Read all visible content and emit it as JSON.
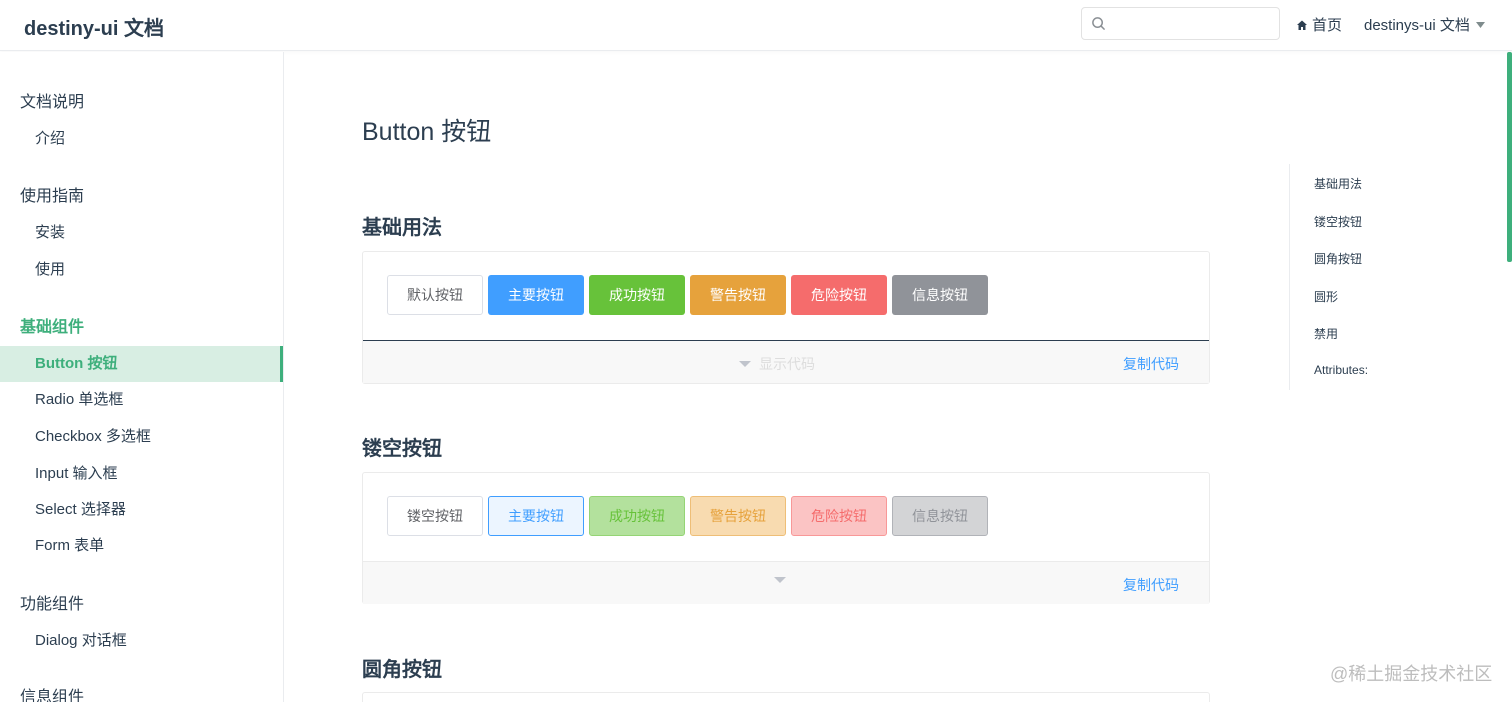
{
  "header": {
    "brand": "destiny-ui 文档",
    "search": {
      "value": "",
      "placeholder": ""
    },
    "home_label": "首页",
    "dropdown_label": "destinys-ui 文档"
  },
  "sidebar": {
    "groups": [
      {
        "title": "文档说明",
        "items": [
          "介绍"
        ]
      },
      {
        "title": "使用指南",
        "items": [
          "安装",
          "使用"
        ]
      },
      {
        "title": "基础组件",
        "items": [
          "Button 按钮",
          "Radio 单选框",
          "Checkbox 多选框",
          "Input 输入框",
          "Select 选择器",
          "Form 表单"
        ]
      },
      {
        "title": "功能组件",
        "items": [
          "Dialog 对话框"
        ]
      },
      {
        "title": "信息组件",
        "items": []
      }
    ],
    "active_item": "Button 按钮"
  },
  "main": {
    "page_title": "Button 按钮",
    "sections": [
      {
        "title": "基础用法",
        "buttons": [
          "默认按钮",
          "主要按钮",
          "成功按钮",
          "警告按钮",
          "危险按钮",
          "信息按钮"
        ],
        "show_code_label": "显示代码",
        "copy_label": "复制代码"
      },
      {
        "title": "镂空按钮",
        "buttons": [
          "镂空按钮",
          "主要按钮",
          "成功按钮",
          "警告按钮",
          "危险按钮",
          "信息按钮"
        ],
        "copy_label": "复制代码"
      },
      {
        "title": "圆角按钮"
      }
    ]
  },
  "toc": [
    "基础用法",
    "镂空按钮",
    "圆角按钮",
    "圆形",
    "禁用",
    "Attributes:"
  ],
  "colors": {
    "accent": "#3eaf7c",
    "primary": "#409eff",
    "success": "#67c23a",
    "warning": "#e6a23c",
    "danger": "#f56c6c",
    "info": "#909399"
  },
  "watermark": "@稀土掘金技术社区"
}
